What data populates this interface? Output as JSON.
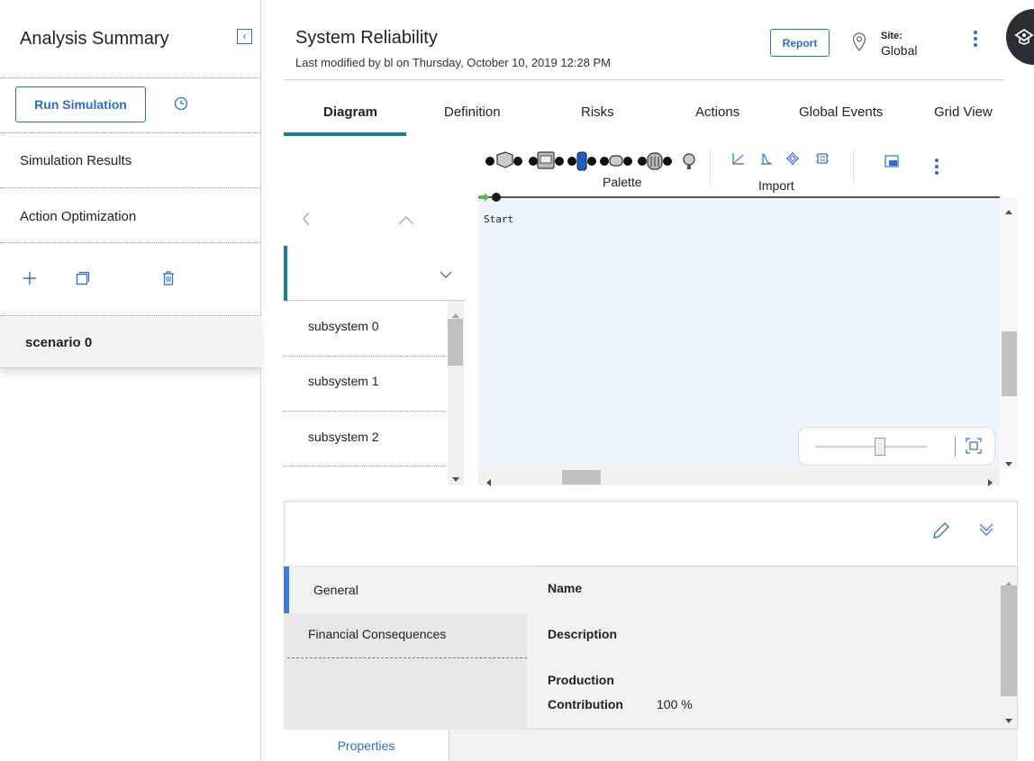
{
  "sidebar": {
    "title": "Analysis Summary",
    "run_simulation_label": "Run Simulation",
    "items": [
      {
        "label": "Simulation Results"
      },
      {
        "label": "Action Optimization"
      }
    ],
    "scenario": "scenario 0"
  },
  "header": {
    "title": "System Reliability",
    "subtitle": "Last modified by bl on Thursday, October 10, 2019 12:28 PM",
    "report_label": "Report",
    "site_label": "Site:",
    "site_value": "Global"
  },
  "tabs": [
    {
      "label": "Diagram",
      "active": true
    },
    {
      "label": "Definition",
      "active": false
    },
    {
      "label": "Risks",
      "active": false
    },
    {
      "label": "Actions",
      "active": false
    },
    {
      "label": "Global Events",
      "active": false
    },
    {
      "label": "Grid View",
      "active": false
    }
  ],
  "toolbar": {
    "palette_label": "Palette",
    "import_label": "Import"
  },
  "subsystems": [
    "subsystem 0",
    "subsystem 1",
    "subsystem 2"
  ],
  "canvas": {
    "start_label": "Start"
  },
  "properties": {
    "nav": [
      "General",
      "Financial Consequences"
    ],
    "fields": {
      "name_label": "Name",
      "description_label": "Description",
      "production_label": "Production",
      "contribution_label": "Contribution",
      "contribution_value": "100 %"
    },
    "tab_label": "Properties"
  },
  "colors": {
    "accent_blue": "#2c6ec6",
    "teal": "#1d7e93",
    "panel_grey": "#f1f2f3"
  }
}
